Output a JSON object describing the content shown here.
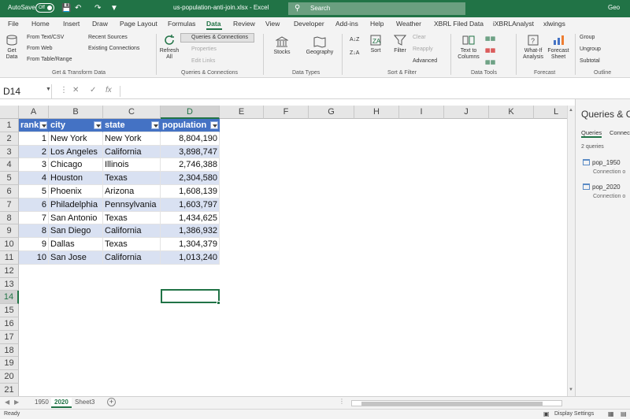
{
  "titlebar": {
    "autosave_label": "AutoSave",
    "autosave_state": "Off",
    "file_name": "us-population-anti-join.xlsx - Excel",
    "search_placeholder": "Search",
    "user": "Geo"
  },
  "menu": [
    "File",
    "Home",
    "Insert",
    "Draw",
    "Page Layout",
    "Formulas",
    "Data",
    "Review",
    "View",
    "Developer",
    "Add-ins",
    "Help",
    "Weather",
    "XBRL Filed Data",
    "iXBRLAnalyst",
    "xlwings"
  ],
  "menu_active": "Data",
  "ribbon": {
    "get_data": "Get Data",
    "from_text_csv": "From Text/CSV",
    "from_web": "From Web",
    "from_table_range": "From Table/Range",
    "recent_sources": "Recent Sources",
    "existing_connections": "Existing Connections",
    "get_transform_label": "Get & Transform Data",
    "refresh_all": "Refresh All",
    "queries_connections": "Queries & Connections",
    "properties": "Properties",
    "edit_links": "Edit Links",
    "qc_group_label": "Queries & Connections",
    "stocks": "Stocks",
    "geography": "Geography",
    "data_types_label": "Data Types",
    "sort": "Sort",
    "filter": "Filter",
    "clear": "Clear",
    "reapply": "Reapply",
    "advanced": "Advanced",
    "sort_filter_label": "Sort & Filter",
    "text_to_columns": "Text to Columns",
    "data_tools_label": "Data Tools",
    "what_if": "What-If Analysis",
    "forecast_sheet": "Forecast Sheet",
    "forecast_label": "Forecast",
    "group": "Group",
    "ungroup": "Ungroup",
    "subtotal": "Subtotal",
    "outline_label": "Outline"
  },
  "formula_bar": {
    "name_box": "D14",
    "fx": "fx",
    "formula": ""
  },
  "columns": [
    "A",
    "B",
    "C",
    "D",
    "E",
    "F",
    "G",
    "H",
    "I",
    "J",
    "K",
    "L"
  ],
  "selected_column": "D",
  "rows": [
    "1",
    "2",
    "3",
    "4",
    "5",
    "6",
    "7",
    "8",
    "9",
    "10",
    "11",
    "12",
    "13",
    "14",
    "15",
    "16",
    "17",
    "18",
    "19",
    "20",
    "21"
  ],
  "selected_row": "14",
  "table_headers": [
    "rank",
    "city",
    "state",
    "population"
  ],
  "table_rows": [
    [
      "1",
      "New York",
      "New York",
      "8,804,190"
    ],
    [
      "2",
      "Los Angeles",
      "California",
      "3,898,747"
    ],
    [
      "3",
      "Chicago",
      "Illinois",
      "2,746,388"
    ],
    [
      "4",
      "Houston",
      "Texas",
      "2,304,580"
    ],
    [
      "5",
      "Phoenix",
      "Arizona",
      "1,608,139"
    ],
    [
      "6",
      "Philadelphia",
      "Pennsylvania",
      "1,603,797"
    ],
    [
      "7",
      "San Antonio",
      "Texas",
      "1,434,625"
    ],
    [
      "8",
      "San Diego",
      "California",
      "1,386,932"
    ],
    [
      "9",
      "Dallas",
      "Texas",
      "1,304,379"
    ],
    [
      "10",
      "San Jose",
      "California",
      "1,013,240"
    ]
  ],
  "pane": {
    "title": "Queries & C",
    "tab_queries": "Queries",
    "tab_connections": "Connec",
    "count": "2 queries",
    "items": [
      {
        "name": "pop_1950",
        "status": "Connection o"
      },
      {
        "name": "pop_2020",
        "status": "Connection o"
      }
    ]
  },
  "sheets": [
    "1950",
    "2020",
    "Sheet3"
  ],
  "active_sheet": "2020",
  "statusbar": {
    "ready": "Ready",
    "display_settings": "Display Settings"
  },
  "colors": {
    "excel_green": "#217346",
    "table_header": "#4472c4",
    "table_band": "#d9e1f2"
  }
}
